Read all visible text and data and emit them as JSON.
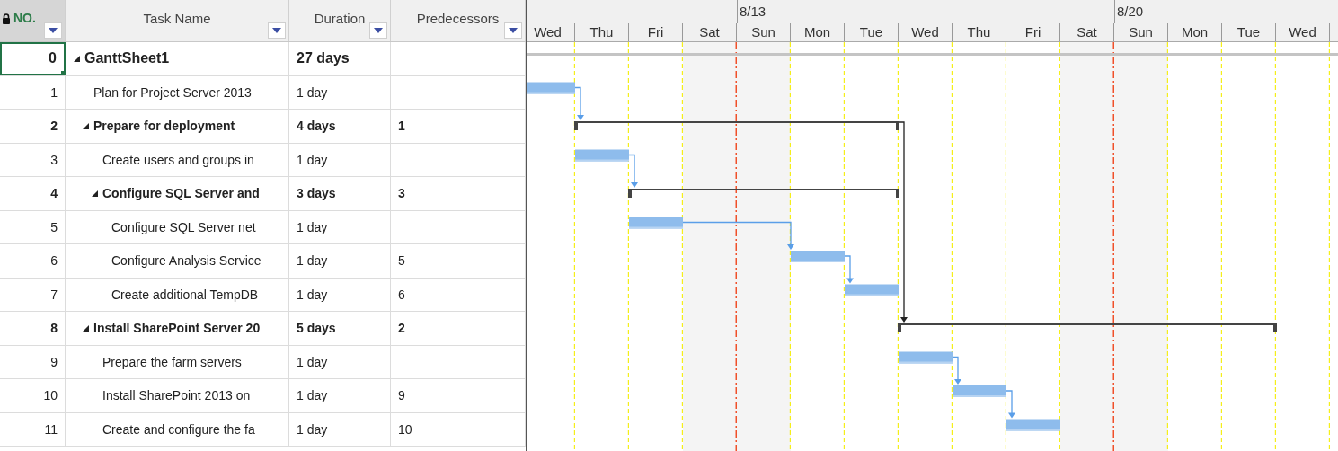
{
  "grid": {
    "columns": [
      {
        "label": "NO.",
        "kind": "id"
      },
      {
        "label": "Task Name",
        "kind": "name"
      },
      {
        "label": "Duration",
        "kind": "duration"
      },
      {
        "label": "Predecessors",
        "kind": "predecessors"
      }
    ]
  },
  "timeline": {
    "days": [
      {
        "label": "Wed",
        "nonworking": false
      },
      {
        "label": "Thu",
        "nonworking": false
      },
      {
        "label": "Fri",
        "nonworking": false
      },
      {
        "label": "Sat",
        "nonworking": true
      },
      {
        "label": "Sun",
        "nonworking": true,
        "week": "8/13"
      },
      {
        "label": "Mon",
        "nonworking": false
      },
      {
        "label": "Tue",
        "nonworking": false
      },
      {
        "label": "Wed",
        "nonworking": false
      },
      {
        "label": "Thu",
        "nonworking": false
      },
      {
        "label": "Fri",
        "nonworking": false
      },
      {
        "label": "Sat",
        "nonworking": true
      },
      {
        "label": "Sun",
        "nonworking": true,
        "week": "8/20"
      },
      {
        "label": "Mon",
        "nonworking": false
      },
      {
        "label": "Tue",
        "nonworking": false
      },
      {
        "label": "Wed",
        "nonworking": false
      }
    ]
  },
  "tasks": [
    {
      "no": "0",
      "name": "GanttSheet1",
      "duration": "27 days",
      "selected": true,
      "expanded": true,
      "children": [
        {
          "no": "1",
          "name": "Plan for Project Server 2013",
          "duration": "1 day",
          "selected": false
        },
        {
          "no": "2",
          "name": "Prepare for deployment",
          "duration": "4 days",
          "predecessors": "1",
          "selected": false,
          "expanded": true,
          "children": [
            {
              "no": "3",
              "name": "Create users and groups in",
              "duration": "1 day",
              "selected": false
            },
            {
              "no": "4",
              "name": "Configure SQL Server and",
              "duration": "3 days",
              "predecessors": "3",
              "selected": false,
              "expanded": true,
              "children": [
                {
                  "no": "5",
                  "name": "Configure SQL Server net",
                  "duration": "1 day",
                  "selected": false
                },
                {
                  "no": "6",
                  "name": "Configure Analysis Service",
                  "duration": "1 day",
                  "predecessors": "5",
                  "selected": false
                },
                {
                  "no": "7",
                  "name": "Create additional TempDB",
                  "duration": "1 day",
                  "predecessors": "6",
                  "selected": false
                }
              ]
            }
          ]
        },
        {
          "no": "8",
          "name": "Install SharePoint Server 20",
          "duration": "5 days",
          "predecessors": "2",
          "selected": false,
          "expanded": true,
          "children": [
            {
              "no": "9",
              "name": "Prepare the farm servers",
              "duration": "1 day",
              "selected": false
            },
            {
              "no": "10",
              "name": "Install SharePoint 2013 on",
              "duration": "1 day",
              "predecessors": "9",
              "selected": false
            },
            {
              "no": "11",
              "name": "Create and configure the fa",
              "duration": "1 day",
              "predecessors": "10",
              "selected": false
            }
          ]
        }
      ]
    }
  ]
}
